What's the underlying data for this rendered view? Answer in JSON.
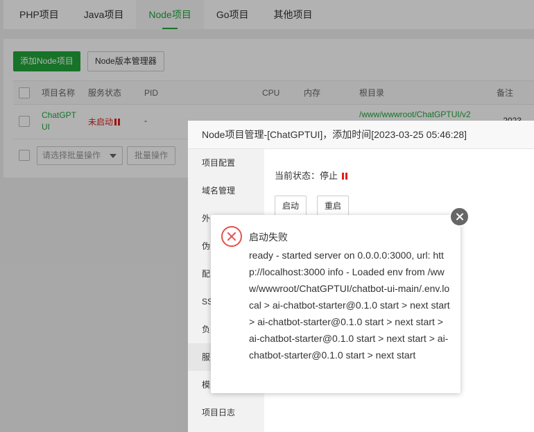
{
  "tabs": [
    {
      "label": "PHP项目"
    },
    {
      "label": "Java项目"
    },
    {
      "label": "Node项目"
    },
    {
      "label": "Go项目"
    },
    {
      "label": "其他项目"
    }
  ],
  "active_tab": "Node项目",
  "toolbar": {
    "add_node_label": "添加Node项目",
    "version_manager_label": "Node版本管理器"
  },
  "table": {
    "headers": {
      "name": "项目名称",
      "status": "服务状态",
      "pid": "PID",
      "cpu": "CPU",
      "memory": "内存",
      "root": "根目录",
      "remark": "备注"
    },
    "rows": [
      {
        "name_line1": "ChatGPT",
        "name_line2": "UI",
        "status": "未启动",
        "pid": "-",
        "root": "/www/wwwroot/ChatGPTUI/v2",
        "remark": " 2023..."
      }
    ]
  },
  "batch": {
    "select_placeholder": "请选择批量操作",
    "button_label": "批量操作"
  },
  "manager_modal": {
    "title": "Node项目管理-[ChatGPTUI]，添加时间[2023-03-25 05:46:28]",
    "side_items": [
      {
        "label": "项目配置"
      },
      {
        "label": "域名管理"
      },
      {
        "label": "外"
      },
      {
        "label": "伪"
      },
      {
        "label": "配"
      },
      {
        "label": "SS"
      },
      {
        "label": "负"
      },
      {
        "label": "服"
      },
      {
        "label": "模"
      },
      {
        "label": "项目日志"
      }
    ],
    "state_label": "当前状态：停止",
    "start_label": "启动",
    "restart_label": "重启"
  },
  "error_dialog": {
    "title": "启动失败",
    "message": "ready - started server on 0.0.0.0:3000, url: http://localhost:3000 info - Loaded env from /www/wwwroot/ChatGPTUI/chatbot-ui-main/.env.local > ai-chatbot-starter@0.1.0 start > next start > ai-chatbot-starter@0.1.0 start > next start > ai-chatbot-starter@0.1.0 start > next start > ai-chatbot-starter@0.1.0 start > next start"
  },
  "colors": {
    "accent": "#20a53a",
    "error": "#e02020"
  }
}
